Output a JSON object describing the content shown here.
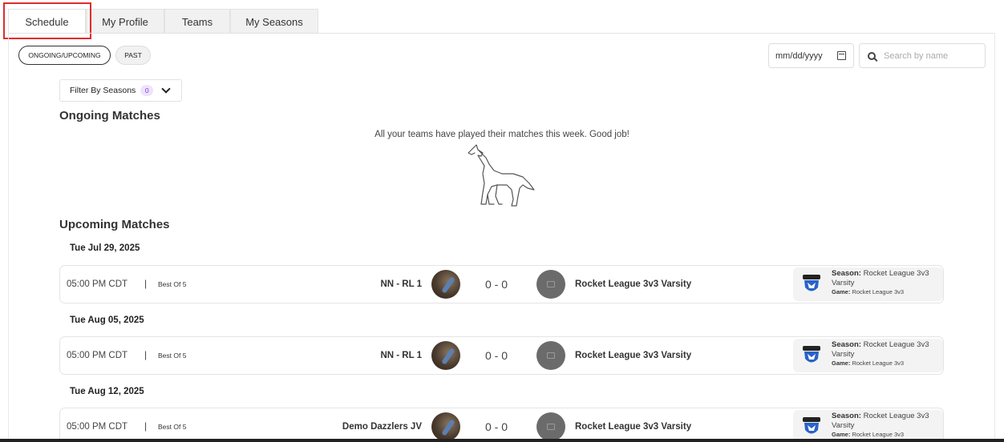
{
  "tabs": [
    {
      "label": "Schedule",
      "active": true
    },
    {
      "label": "My Profile",
      "active": false
    },
    {
      "label": "Teams",
      "active": false
    },
    {
      "label": "My Seasons",
      "active": false
    }
  ],
  "filters": {
    "ongoing_label": "ONGOING/UPCOMING",
    "past_label": "PAST",
    "date_placeholder": "mm/dd/yyyy",
    "search_placeholder": "Search by name",
    "season_filter_label": "Filter By Seasons",
    "season_filter_count": "0"
  },
  "ongoing": {
    "title": "Ongoing Matches",
    "empty_message": "All your teams have played their matches this week. Good job!"
  },
  "upcoming": {
    "title": "Upcoming Matches",
    "groups": [
      {
        "date": "Tue Jul 29, 2025",
        "match": {
          "time": "05:00 PM CDT",
          "separator": "|",
          "format": "Best Of 5",
          "team1": "NN - RL 1",
          "score": "0 - 0",
          "team2": "Rocket League 3v3 Varsity",
          "season_label": "Season:",
          "season_value": "Rocket League 3v3 Varsity",
          "game_label": "Game:",
          "game_value": "Rocket League 3v3"
        }
      },
      {
        "date": "Tue Aug 05, 2025",
        "match": {
          "time": "05:00 PM CDT",
          "separator": "|",
          "format": "Best Of 5",
          "team1": "NN - RL 1",
          "score": "0 - 0",
          "team2": "Rocket League 3v3 Varsity",
          "season_label": "Season:",
          "season_value": "Rocket League 3v3 Varsity",
          "game_label": "Game:",
          "game_value": "Rocket League 3v3"
        }
      },
      {
        "date": "Tue Aug 12, 2025",
        "match": {
          "time": "05:00 PM CDT",
          "separator": "|",
          "format": "Best Of 5",
          "team1": "Demo Dazzlers JV",
          "score": "0 - 0",
          "team2": "Rocket League 3v3 Varsity",
          "season_label": "Season:",
          "season_value": "Rocket League 3v3 Varsity",
          "game_label": "Game:",
          "game_value": "Rocket League 3v3"
        }
      }
    ]
  },
  "colors": {
    "highlight": "#e12b2b",
    "badge_bg": "#efe3fb",
    "badge_text": "#7c3aed"
  },
  "icons": {
    "calendar": "calendar-icon",
    "search": "search-icon",
    "chevron": "chevron-down-icon",
    "empty_state": "wolf-howling-icon",
    "team_placeholder": "image-placeholder-icon",
    "game_logo": "rocket-league-icon"
  }
}
